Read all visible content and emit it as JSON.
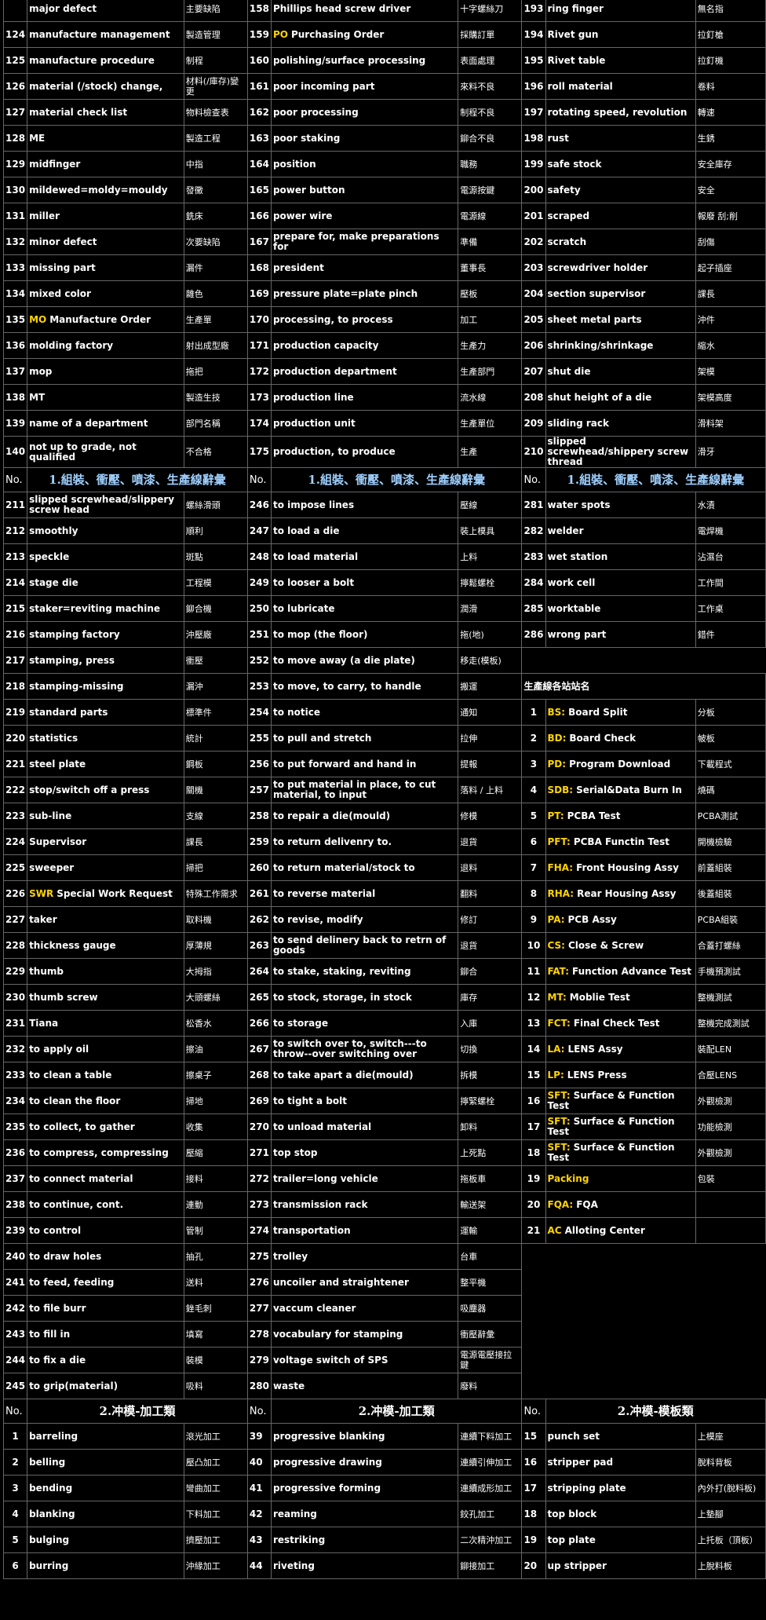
{
  "hdr1": {
    "no": "No.",
    "title": "1.組裝、衝壓、噴漆、生產線辭彙"
  },
  "hdr2": {
    "no": "No.",
    "title": "2.冲模-加工類"
  },
  "hdr3": {
    "no": "No.",
    "title": "2.冲模-模板類"
  },
  "stations_title": "生產線各站站名",
  "sec1_top": [
    [
      {
        "n": "",
        "en": "major defect",
        "zh": "主要缺陷"
      },
      {
        "n": "158",
        "en": "Phillips head screw driver",
        "zh": "十字螺絲刀"
      },
      {
        "n": "193",
        "en": "ring finger",
        "zh": "無名指"
      }
    ],
    [
      {
        "n": "124",
        "en": "manufacture management",
        "zh": "製造管理"
      },
      {
        "n": "159",
        "code": "PO",
        "en": "Purchasing Order",
        "zh": "採購訂單"
      },
      {
        "n": "194",
        "en": "Rivet gun",
        "zh": "拉釘槍"
      }
    ],
    [
      {
        "n": "125",
        "en": "manufacture procedure",
        "zh": "制程"
      },
      {
        "n": "160",
        "en": "polishing/surface processing",
        "zh": "表面處理"
      },
      {
        "n": "195",
        "en": "Rivet table",
        "zh": "拉釘機"
      }
    ],
    [
      {
        "n": "126",
        "en": "material (/stock) change,",
        "zh": "材料(/庫存)變更"
      },
      {
        "n": "161",
        "en": "poor incoming part",
        "zh": "來料不良"
      },
      {
        "n": "196",
        "en": "roll material",
        "zh": "卷料"
      }
    ],
    [
      {
        "n": "127",
        "en": "material check list",
        "zh": "物料檢查表"
      },
      {
        "n": "162",
        "en": "poor processing",
        "zh": "制程不良"
      },
      {
        "n": "197",
        "en": "rotating speed, revolution",
        "zh": "轉速"
      }
    ],
    [
      {
        "n": "128",
        "en": "ME",
        "zh": "製造工程"
      },
      {
        "n": "163",
        "en": "poor staking",
        "zh": "鉚合不良"
      },
      {
        "n": "198",
        "en": "rust",
        "zh": "生銹"
      }
    ],
    [
      {
        "n": "129",
        "en": "midfinger",
        "zh": "中指"
      },
      {
        "n": "164",
        "en": "position",
        "zh": "職務"
      },
      {
        "n": "199",
        "en": "safe stock",
        "zh": "安全庫存"
      }
    ],
    [
      {
        "n": "130",
        "en": "mildewed=moldy=mouldy",
        "zh": "發黴"
      },
      {
        "n": "165",
        "en": "power button",
        "zh": "電源按鍵"
      },
      {
        "n": "200",
        "en": "safety",
        "zh": "安全"
      }
    ],
    [
      {
        "n": "131",
        "en": "miller",
        "zh": "銑床"
      },
      {
        "n": "166",
        "en": "power wire",
        "zh": "電源線"
      },
      {
        "n": "201",
        "en": "scraped",
        "zh": "報廢 刮;削"
      }
    ],
    [
      {
        "n": "132",
        "en": "minor defect",
        "zh": "次要缺陷"
      },
      {
        "n": "167",
        "en": "prepare for, make preparations for",
        "zh": "準備"
      },
      {
        "n": "202",
        "en": "scratch",
        "zh": "刮傷"
      }
    ],
    [
      {
        "n": "133",
        "en": "missing part",
        "zh": "漏件"
      },
      {
        "n": "168",
        "en": "president",
        "zh": "董事長"
      },
      {
        "n": "203",
        "en": "screwdriver holder",
        "zh": "起子插座"
      }
    ],
    [
      {
        "n": "134",
        "en": "mixed color",
        "zh": "雜色"
      },
      {
        "n": "169",
        "en": "pressure plate=plate pinch",
        "zh": "壓板"
      },
      {
        "n": "204",
        "en": "section supervisor",
        "zh": "課長"
      }
    ],
    [
      {
        "n": "135",
        "code": "MO",
        "en": "Manufacture Order",
        "zh": "生產單"
      },
      {
        "n": "170",
        "en": "processing, to process",
        "zh": "加工"
      },
      {
        "n": "205",
        "en": "sheet metal parts",
        "zh": "沖件"
      }
    ],
    [
      {
        "n": "136",
        "en": "molding factory",
        "zh": "射出成型廠"
      },
      {
        "n": "171",
        "en": "production capacity",
        "zh": "生產力"
      },
      {
        "n": "206",
        "en": "shrinking/shrinkage",
        "zh": "縮水"
      }
    ],
    [
      {
        "n": "137",
        "en": "mop",
        "zh": "拖把"
      },
      {
        "n": "172",
        "en": "production department",
        "zh": "生產部門"
      },
      {
        "n": "207",
        "en": "shut die",
        "zh": "架模"
      }
    ],
    [
      {
        "n": "138",
        "en": "MT",
        "zh": "製造生技"
      },
      {
        "n": "173",
        "en": "production line",
        "zh": "流水線"
      },
      {
        "n": "208",
        "en": "shut height of a die",
        "zh": "架模高度"
      }
    ],
    [
      {
        "n": "139",
        "en": "name of a department",
        "zh": "部門名稱"
      },
      {
        "n": "174",
        "en": "production unit",
        "zh": "生產單位"
      },
      {
        "n": "209",
        "en": "sliding rack",
        "zh": "滑料架"
      }
    ],
    [
      {
        "n": "140",
        "en": "not up to grade, not qualified",
        "zh": "不合格"
      },
      {
        "n": "175",
        "en": "production, to produce",
        "zh": "生產"
      },
      {
        "n": "210",
        "en": "slipped screwhead/shippery screw thread",
        "zh": "滑牙"
      }
    ]
  ],
  "sec1_main": [
    [
      {
        "n": "211",
        "en": "slipped screwhead/slippery screw head",
        "zh": "螺絲滑頭"
      },
      {
        "n": "246",
        "en": "to impose lines",
        "zh": "壓線"
      },
      {
        "n": "281",
        "en": "water spots",
        "zh": "水漬"
      }
    ],
    [
      {
        "n": "212",
        "en": "smoothly",
        "zh": "順利"
      },
      {
        "n": "247",
        "en": "to load a die",
        "zh": "裝上模具"
      },
      {
        "n": "282",
        "en": "welder",
        "zh": "電焊機"
      }
    ],
    [
      {
        "n": "213",
        "en": "speckle",
        "zh": "斑點"
      },
      {
        "n": "248",
        "en": "to load material",
        "zh": "上料"
      },
      {
        "n": "283",
        "en": "wet station",
        "zh": "沾濕台"
      }
    ],
    [
      {
        "n": "214",
        "en": "stage die",
        "zh": "工程模"
      },
      {
        "n": "249",
        "en": "to looser a bolt",
        "zh": "擰鬆螺栓"
      },
      {
        "n": "284",
        "en": "work cell",
        "zh": "工作間"
      }
    ],
    [
      {
        "n": "215",
        "en": "staker=reviting machine",
        "zh": "鉚合機"
      },
      {
        "n": "250",
        "en": "to lubricate",
        "zh": "潤滑"
      },
      {
        "n": "285",
        "en": "worktable",
        "zh": "工作桌"
      }
    ],
    [
      {
        "n": "216",
        "en": "stamping factory",
        "zh": "沖壓廠"
      },
      {
        "n": "251",
        "en": "to mop (the floor)",
        "zh": "拖(地)"
      },
      {
        "n": "286",
        "en": "wrong part",
        "zh": "錯件"
      }
    ],
    [
      {
        "n": "217",
        "en": "stamping, press",
        "zh": "衝壓"
      },
      {
        "n": "252",
        "en": "to move away (a die plate)",
        "zh": "移走(模板)"
      }
    ],
    [
      {
        "n": "218",
        "en": "stamping-missing",
        "zh": "漏沖"
      },
      {
        "n": "253",
        "en": "to move, to carry, to handle",
        "zh": "搬運"
      },
      "STHDR"
    ],
    [
      {
        "n": "219",
        "en": "standard parts",
        "zh": "標準件"
      },
      {
        "n": "254",
        "en": "to notice",
        "zh": "通知"
      },
      {
        "n": "1",
        "sn": true,
        "code": "BS:",
        "en": "Board Split",
        "zh": "分板"
      }
    ],
    [
      {
        "n": "220",
        "en": "statistics",
        "zh": "統計"
      },
      {
        "n": "255",
        "en": "to pull and stretch",
        "zh": "拉伸"
      },
      {
        "n": "2",
        "sn": true,
        "code": "BD:",
        "en": "Board Check",
        "zh": "帔板"
      }
    ],
    [
      {
        "n": "221",
        "en": "steel plate",
        "zh": "鋼板"
      },
      {
        "n": "256",
        "en": "to put forward and hand in",
        "zh": "提報"
      },
      {
        "n": "3",
        "sn": true,
        "code": "PD:",
        "en": "Program Download",
        "zh": "下載程式"
      }
    ],
    [
      {
        "n": "222",
        "en": "stop/switch off a press",
        "zh": "關機"
      },
      {
        "n": "257",
        "en": "to put material in place, to cut material, to input",
        "zh": "落料 / 上料"
      },
      {
        "n": "4",
        "sn": true,
        "code": "SDB:",
        "en": "Serial&Data Burn In",
        "zh": "燒碼"
      }
    ],
    [
      {
        "n": "223",
        "en": "sub-line",
        "zh": "支線"
      },
      {
        "n": "258",
        "en": "to repair a die(mould)",
        "zh": "修模"
      },
      {
        "n": "5",
        "sn": true,
        "code": "PT:",
        "en": "PCBA Test",
        "zh": "PCBA測試"
      }
    ],
    [
      {
        "n": "224",
        "en": "Supervisor",
        "zh": "課長"
      },
      {
        "n": "259",
        "en": "to return delivenry to.",
        "zh": "退貨"
      },
      {
        "n": "6",
        "sn": true,
        "code": "PFT:",
        "en": "PCBA Functin Test",
        "zh": "開機檢驗"
      }
    ],
    [
      {
        "n": "225",
        "en": "sweeper",
        "zh": "掃把"
      },
      {
        "n": "260",
        "en": "to return material/stock to",
        "zh": "退料"
      },
      {
        "n": "7",
        "sn": true,
        "code": "FHA:",
        "en": "Front Housing Assy",
        "zh": "前蓋組裝"
      }
    ],
    [
      {
        "n": "226",
        "code": "SWR",
        "en": "Special Work Request",
        "zh": "特殊工作需求"
      },
      {
        "n": "261",
        "en": "to reverse material",
        "zh": "翻料"
      },
      {
        "n": "8",
        "sn": true,
        "code": "RHA:",
        "en": "Rear Housing Assy",
        "zh": "後蓋組裝"
      }
    ],
    [
      {
        "n": "227",
        "en": "taker",
        "zh": "取料機"
      },
      {
        "n": "262",
        "en": "to revise, modify",
        "zh": "修訂"
      },
      {
        "n": "9",
        "sn": true,
        "code": "PA:",
        "en": "PCB Assy",
        "zh": "PCBA組裝"
      }
    ],
    [
      {
        "n": "228",
        "en": "thickness gauge",
        "zh": "厚薄規"
      },
      {
        "n": "263",
        "en": "to send delinery back to retrn of goods",
        "zh": "退貨"
      },
      {
        "n": "10",
        "sn": true,
        "code": "CS:",
        "en": "Close & Screw",
        "zh": "合蓋打螺絲"
      }
    ],
    [
      {
        "n": "229",
        "en": "thumb",
        "zh": "大拇指"
      },
      {
        "n": "264",
        "en": "to stake, staking, reviting",
        "zh": "鉚合"
      },
      {
        "n": "11",
        "sn": true,
        "code": "FAT:",
        "en": "Function Advance Test",
        "zh": "手機預測試"
      }
    ],
    [
      {
        "n": "230",
        "en": "thumb screw",
        "zh": "大頭螺絲"
      },
      {
        "n": "265",
        "en": "to stock, storage, in stock",
        "zh": "庫存"
      },
      {
        "n": "12",
        "sn": true,
        "code": "MT:",
        "en": "Moblie Test",
        "zh": "整機測試"
      }
    ],
    [
      {
        "n": "231",
        "en": "Tiana",
        "zh": "松香水"
      },
      {
        "n": "266",
        "en": "to storage",
        "zh": "入庫"
      },
      {
        "n": "13",
        "sn": true,
        "code": "FCT:",
        "en": "Final Check Test",
        "zh": "整機完成測試"
      }
    ],
    [
      {
        "n": "232",
        "en": "to apply oil",
        "zh": "擦油"
      },
      {
        "n": "267",
        "en": "to switch over to, switch---to throw--over switching over",
        "zh": "切換"
      },
      {
        "n": "14",
        "sn": true,
        "code": "LA:",
        "en": "LENS Assy",
        "zh": "裝配LEN"
      }
    ],
    [
      {
        "n": "233",
        "en": "to clean a table",
        "zh": "擦桌子"
      },
      {
        "n": "268",
        "en": "to take apart a die(mould)",
        "zh": "拆模"
      },
      {
        "n": "15",
        "sn": true,
        "code": "LP:",
        "en": "LENS Press",
        "zh": "合壓LENS"
      }
    ],
    [
      {
        "n": "234",
        "en": "to clean the floor",
        "zh": "掃地"
      },
      {
        "n": "269",
        "en": "to tight a bolt",
        "zh": "擰緊螺栓"
      },
      {
        "n": "16",
        "sn": true,
        "code": "SFT:",
        "en": "Surface & Function Test",
        "zh": "外觀檢測"
      }
    ],
    [
      {
        "n": "235",
        "en": "to collect, to gather",
        "zh": "收集"
      },
      {
        "n": "270",
        "en": "to unload material",
        "zh": "卸料"
      },
      {
        "n": "17",
        "sn": true,
        "code": "SFT:",
        "en": "Surface & Function Test",
        "zh": "功能檢測"
      }
    ],
    [
      {
        "n": "236",
        "en": "to compress, compressing",
        "zh": "壓縮"
      },
      {
        "n": "271",
        "en": "top stop",
        "zh": "上死點"
      },
      {
        "n": "18",
        "sn": true,
        "code": "SFT:",
        "en": "Surface & Function Test",
        "zh": "外觀檢測"
      }
    ],
    [
      {
        "n": "237",
        "en": "to connect material",
        "zh": "接料"
      },
      {
        "n": "272",
        "en": "trailer=long vehicle",
        "zh": "拖板車"
      },
      {
        "n": "19",
        "sn": true,
        "code": "Packing",
        "en": "",
        "zh": "包裝"
      }
    ],
    [
      {
        "n": "238",
        "en": "to continue, cont.",
        "zh": "連動"
      },
      {
        "n": "273",
        "en": "transmission rack",
        "zh": "輸送架"
      },
      {
        "n": "20",
        "sn": true,
        "code": "FQA:",
        "en": "FQA",
        "zh": ""
      }
    ],
    [
      {
        "n": "239",
        "en": "to control",
        "zh": "管制"
      },
      {
        "n": "274",
        "en": "transportation",
        "zh": "運輸"
      },
      {
        "n": "21",
        "sn": true,
        "code": "AC",
        "en": "Alloting Center",
        "zh": ""
      }
    ],
    [
      {
        "n": "240",
        "en": "to draw holes",
        "zh": "抽孔"
      },
      {
        "n": "275",
        "en": "trolley",
        "zh": "台車"
      }
    ],
    [
      {
        "n": "241",
        "en": "to feed, feeding",
        "zh": "送料"
      },
      {
        "n": "276",
        "en": "uncoiler and straightener",
        "zh": "整平機"
      }
    ],
    [
      {
        "n": "242",
        "en": "to file burr",
        "zh": "銼毛刺"
      },
      {
        "n": "277",
        "en": "vaccum cleaner",
        "zh": "吸塵器"
      }
    ],
    [
      {
        "n": "243",
        "en": "to fill in",
        "zh": "填寫"
      },
      {
        "n": "278",
        "en": "vocabulary for stamping",
        "zh": "衝壓辭彙"
      }
    ],
    [
      {
        "n": "244",
        "en": "to fix a die",
        "zh": "裝模"
      },
      {
        "n": "279",
        "en": "voltage switch of SPS",
        "zh": "電源電壓接拉鍵"
      }
    ],
    [
      {
        "n": "245",
        "en": "to grip(material)",
        "zh": "吸料"
      },
      {
        "n": "280",
        "en": "waste",
        "zh": "廢料"
      }
    ]
  ],
  "sec2": [
    [
      {
        "n": "1",
        "sn": true,
        "en": "barreling",
        "zh": "滾光加工"
      },
      {
        "n": "39",
        "en": "progressive blanking",
        "zh": "連續下料加工"
      },
      {
        "n": "15",
        "en": "punch set",
        "zh": "上模座"
      }
    ],
    [
      {
        "n": "2",
        "sn": true,
        "en": "belling",
        "zh": "壓凸加工"
      },
      {
        "n": "40",
        "en": "progressive drawing",
        "zh": "連續引伸加工"
      },
      {
        "n": "16",
        "en": "stripper pad",
        "zh": "脫料背板"
      }
    ],
    [
      {
        "n": "3",
        "sn": true,
        "en": "bending",
        "zh": "彎曲加工"
      },
      {
        "n": "41",
        "en": "progressive forming",
        "zh": "連續成形加工"
      },
      {
        "n": "17",
        "en": "stripping plate",
        "zh": "內外打(脫料板)"
      }
    ],
    [
      {
        "n": "4",
        "sn": true,
        "en": "blanking",
        "zh": "下料加工"
      },
      {
        "n": "42",
        "en": "reaming",
        "zh": "鉸孔加工"
      },
      {
        "n": "18",
        "en": "top block",
        "zh": "上墊腳"
      }
    ],
    [
      {
        "n": "5",
        "sn": true,
        "en": "bulging",
        "zh": "擠壓加工"
      },
      {
        "n": "43",
        "en": "restriking",
        "zh": "二次精沖加工"
      },
      {
        "n": "19",
        "en": "top plate",
        "zh": "上托板（頂板）"
      }
    ],
    [
      {
        "n": "6",
        "sn": true,
        "en": "burring",
        "zh": "沖緣加工"
      },
      {
        "n": "44",
        "en": "riveting",
        "zh": "鉚接加工"
      },
      {
        "n": "20",
        "en": "up stripper",
        "zh": "上脫料板"
      }
    ]
  ]
}
